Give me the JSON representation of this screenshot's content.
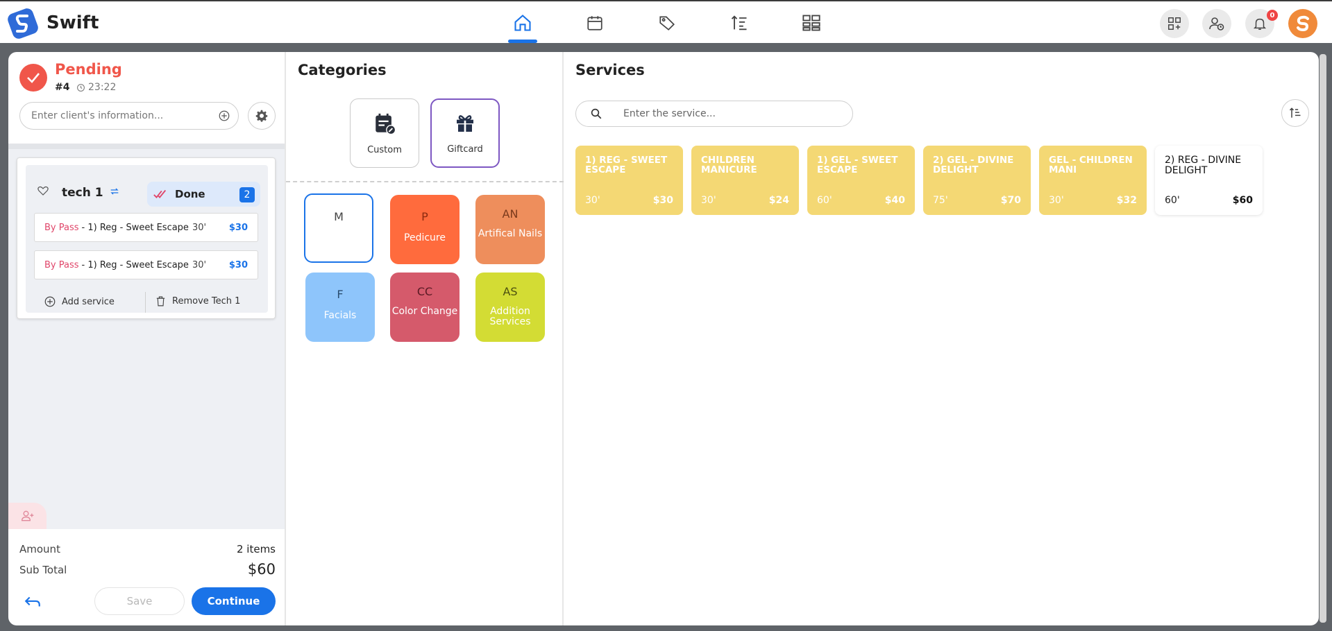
{
  "app": {
    "brand": "Swift"
  },
  "nav": {
    "items": [
      {
        "name": "home",
        "icon": "home-icon",
        "active": true
      },
      {
        "name": "calendar",
        "icon": "calendar-icon",
        "active": false
      },
      {
        "name": "tags",
        "icon": "tag-icon",
        "active": false
      },
      {
        "name": "sort",
        "icon": "sort-icon",
        "active": false
      },
      {
        "name": "layout",
        "icon": "grid-icon",
        "active": false
      }
    ]
  },
  "header_actions": {
    "notification_count": "0",
    "avatar_letter": "S"
  },
  "order": {
    "status": "Pending",
    "number": "#4",
    "time": "23:22",
    "client_placeholder": "Enter client's information...",
    "tech": {
      "name": "tech 1",
      "done_label": "Done",
      "done_count": "2",
      "services": [
        {
          "bypass": "By Pass",
          "name": "- 1) Reg - Sweet Escape",
          "duration": "30'",
          "price": "$30"
        },
        {
          "bypass": "By Pass",
          "name": "- 1) Reg - Sweet Escape",
          "duration": "30'",
          "price": "$30"
        }
      ],
      "add_service_label": "Add service",
      "remove_label": "Remove Tech 1"
    },
    "amount_label": "Amount",
    "amount_value": "2 items",
    "subtotal_label": "Sub Total",
    "subtotal_value": "$60",
    "save_label": "Save",
    "continue_label": "Continue"
  },
  "categories": {
    "title": "Categories",
    "top": [
      {
        "label": "Custom",
        "icon": "custom-calendar-icon"
      },
      {
        "label": "Giftcard",
        "icon": "gift-icon"
      }
    ],
    "tiles": [
      {
        "abbr": "M",
        "name": "",
        "color": "#ffffff",
        "selected": true
      },
      {
        "abbr": "P",
        "name": "Pedicure",
        "color": "#ff6b3d"
      },
      {
        "abbr": "AN",
        "name": "Artifical Nails",
        "color": "#ee8e5c"
      },
      {
        "abbr": "F",
        "name": "Facials",
        "color": "#8ec5fb"
      },
      {
        "abbr": "CC",
        "name": "Color Change",
        "color": "#d55a6b"
      },
      {
        "abbr": "AS",
        "name": "Addition Services",
        "color": "#d3dc34"
      }
    ]
  },
  "services": {
    "title": "Services",
    "search_placeholder": "Enter the service...",
    "items": [
      {
        "name": "1) REG - SWEET ESCAPE",
        "duration": "30'",
        "price": "$30",
        "color": "#f4d874"
      },
      {
        "name": "CHILDREN MANICURE",
        "duration": "30'",
        "price": "$24",
        "color": "#f4d874"
      },
      {
        "name": "1) GEL - SWEET ESCAPE",
        "duration": "60'",
        "price": "$40",
        "color": "#f4d874"
      },
      {
        "name": "2) GEL - DIVINE DELIGHT",
        "duration": "75'",
        "price": "$70",
        "color": "#f4d874"
      },
      {
        "name": "GEL - CHILDREN MANI",
        "duration": "30'",
        "price": "$32",
        "color": "#f4d874"
      },
      {
        "name": "2) REG - DIVINE DELIGHT",
        "duration": "60'",
        "price": "$60",
        "color": "#ffffff"
      }
    ]
  }
}
